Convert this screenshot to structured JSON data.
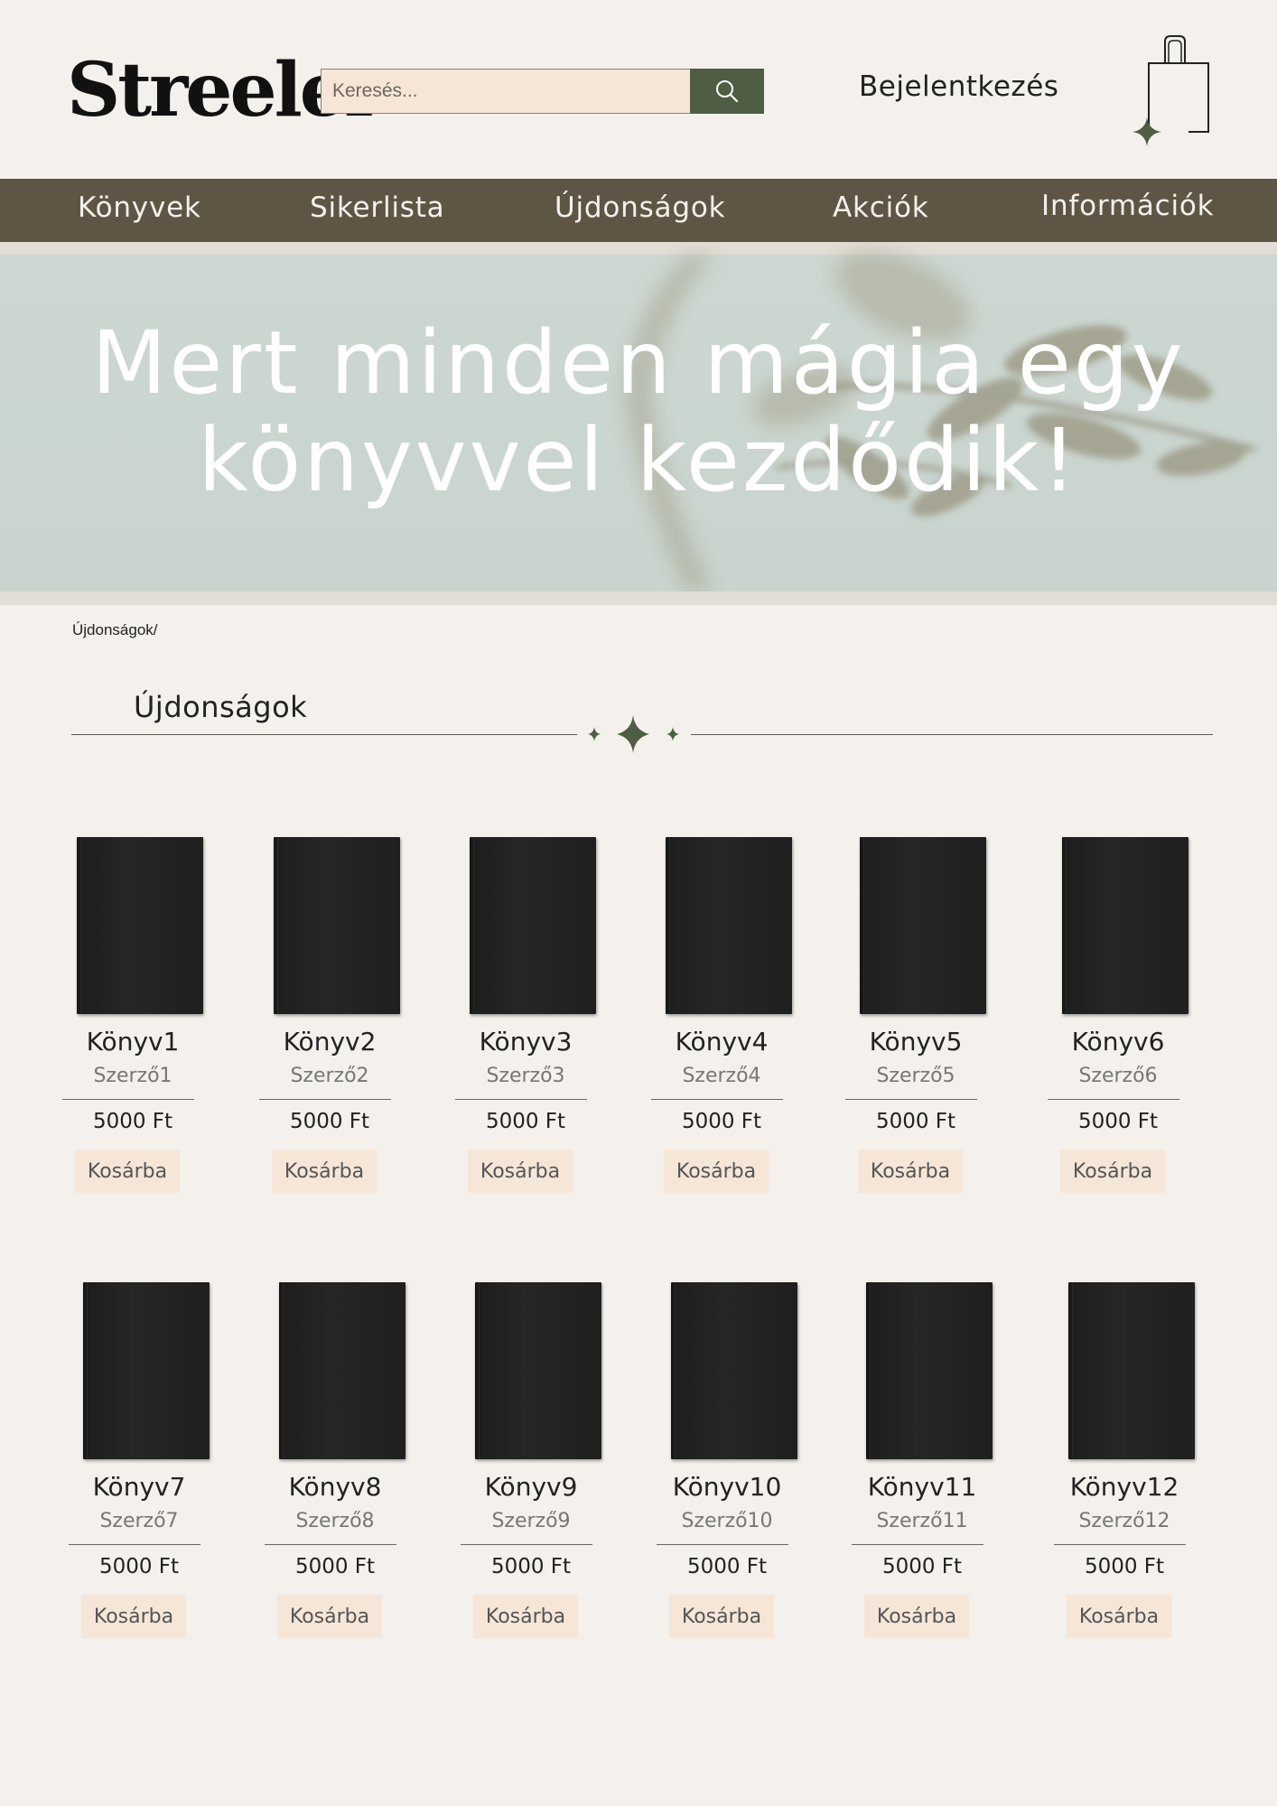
{
  "header": {
    "logo_text": "Streeler",
    "search_placeholder": "Keresés...",
    "login_label": "Bejelentkezés"
  },
  "icons": {
    "search": "search-icon",
    "cart": "shopping-bag-icon",
    "sparkle": "sparkle-icon"
  },
  "nav": {
    "items": [
      {
        "label": "Könyvek"
      },
      {
        "label": "Sikerlista"
      },
      {
        "label": "Újdonságok"
      },
      {
        "label": "Akciók"
      },
      {
        "label": "Információk"
      }
    ]
  },
  "hero": {
    "line1": "Mert minden mágia egy",
    "line2": "könyvvel kezdődik!"
  },
  "breadcrumb": "Újdonságok/",
  "section_title": "Újdonságok",
  "colors": {
    "background": "#f4f0ec",
    "nav_bar": "#5e5544",
    "search_button": "#4e5d43",
    "button_fill": "#f5e6d8",
    "accent_star": "#4e5d43"
  },
  "products": [
    {
      "title": "Könyv1",
      "author": "Szerző1",
      "price": "5000 Ft",
      "button": "Kosárba"
    },
    {
      "title": "Könyv2",
      "author": "Szerző2",
      "price": "5000 Ft",
      "button": "Kosárba"
    },
    {
      "title": "Könyv3",
      "author": "Szerző3",
      "price": "5000 Ft",
      "button": "Kosárba"
    },
    {
      "title": "Könyv4",
      "author": "Szerző4",
      "price": "5000 Ft",
      "button": "Kosárba"
    },
    {
      "title": "Könyv5",
      "author": "Szerző5",
      "price": "5000 Ft",
      "button": "Kosárba"
    },
    {
      "title": "Könyv6",
      "author": "Szerző6",
      "price": "5000 Ft",
      "button": "Kosárba"
    },
    {
      "title": "Könyv7",
      "author": "Szerző7",
      "price": "5000 Ft",
      "button": "Kosárba"
    },
    {
      "title": "Könyv8",
      "author": "Szerző8",
      "price": "5000 Ft",
      "button": "Kosárba"
    },
    {
      "title": "Könyv9",
      "author": "Szerző9",
      "price": "5000 Ft",
      "button": "Kosárba"
    },
    {
      "title": "Könyv10",
      "author": "Szerző10",
      "price": "5000 Ft",
      "button": "Kosárba"
    },
    {
      "title": "Könyv11",
      "author": "Szerző11",
      "price": "5000 Ft",
      "button": "Kosárba"
    },
    {
      "title": "Könyv12",
      "author": "Szerző12",
      "price": "5000 Ft",
      "button": "Kosárba"
    }
  ]
}
